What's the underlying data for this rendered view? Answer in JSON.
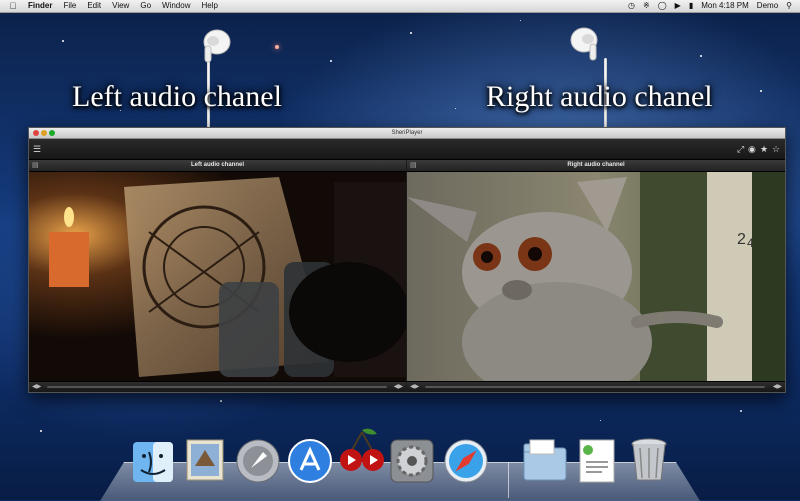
{
  "menubar": {
    "apple_icon": "apple-logo-icon",
    "app_name": "Finder",
    "menus": [
      "File",
      "Edit",
      "View",
      "Go",
      "Window",
      "Help"
    ],
    "clock": "Mon 4:18 PM",
    "user": "Demo",
    "status_icons": [
      "time-machine-icon",
      "bluetooth-icon",
      "wifi-icon",
      "volume-icon",
      "battery-icon",
      "spotlight-icon"
    ]
  },
  "captions": {
    "left": "Left audio chanel",
    "right": "Right audio chanel"
  },
  "window": {
    "title": "SheriPlayer",
    "panes": [
      {
        "label": "Left audio channel",
        "video": "candlelit-scene-with-parchment-and-bottles"
      },
      {
        "label": "Right audio channel",
        "video": "bushbaby-clinging-to-measuring-pole"
      }
    ],
    "toolbar_icons": [
      "playlist-icon",
      "fullscreen-icon",
      "snapshot-icon",
      "favorite-star-icon",
      "rating-star-icon"
    ]
  },
  "dock": {
    "apps": [
      "Finder",
      "Mail",
      "Launchpad",
      "App Store",
      "SheriPlayer",
      "System Preferences",
      "Safari",
      "Documents",
      "Preview",
      "Trash"
    ]
  },
  "colors": {
    "menubar": "#e4e4e4",
    "window_chrome": "#1b1b1b",
    "desktop_blue": "#163d80"
  }
}
